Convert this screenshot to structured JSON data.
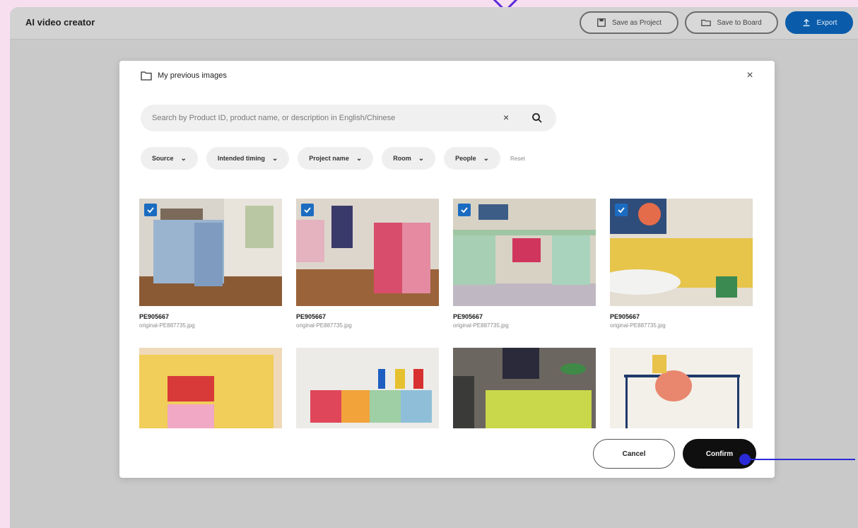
{
  "app": {
    "title": "AI video creator",
    "actions": {
      "save_project": "Save as Project",
      "save_board": "Save to Board",
      "export": "Export"
    }
  },
  "modal": {
    "title": "My previous images",
    "close_label": "×",
    "search": {
      "placeholder": "Search by Product ID, product name, or description in English/Chinese",
      "clear_label": "×"
    },
    "filters": [
      {
        "label": "Source"
      },
      {
        "label": "Intended timing"
      },
      {
        "label": "Project name"
      },
      {
        "label": "Room"
      },
      {
        "label": "People"
      }
    ],
    "filters_reset": "Reset",
    "images": [
      {
        "id": "PE905667",
        "file": "original-PE887735.jpg",
        "selected": true
      },
      {
        "id": "PE905667",
        "file": "original-PE887735.jpg",
        "selected": true
      },
      {
        "id": "PE905667",
        "file": "original-PE887735.jpg",
        "selected": true
      },
      {
        "id": "PE905667",
        "file": "original-PE887735.jpg",
        "selected": true
      },
      {
        "id": "",
        "file": "",
        "selected": false
      },
      {
        "id": "",
        "file": "",
        "selected": false
      },
      {
        "id": "",
        "file": "",
        "selected": false
      },
      {
        "id": "",
        "file": "",
        "selected": false
      }
    ],
    "cancel_label": "Cancel",
    "confirm_label": "Confirm"
  },
  "colors": {
    "accent": "#0a5cab",
    "checkbox": "#1b6cc0",
    "annotation": "#2a2ad8"
  }
}
